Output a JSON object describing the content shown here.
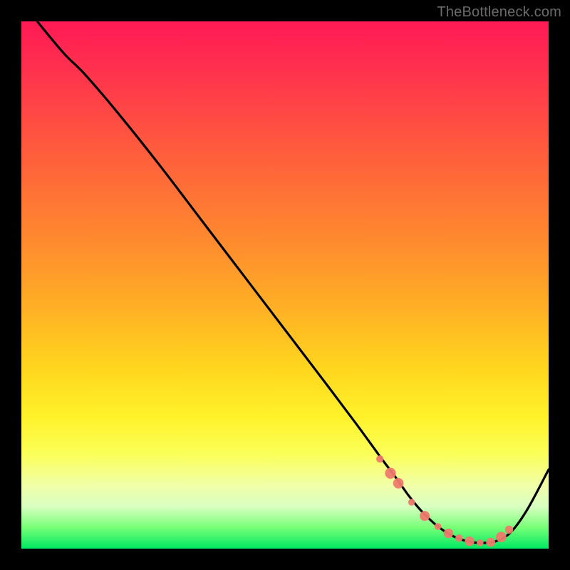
{
  "watermark": "TheBottleneck.com",
  "chart_data": {
    "type": "line",
    "title": "",
    "xlabel": "",
    "ylabel": "",
    "xlim": [
      0,
      100
    ],
    "ylim": [
      0,
      100
    ],
    "series": [
      {
        "name": "curve",
        "color": "#000000",
        "x": [
          3,
          8,
          12,
          18,
          26,
          34,
          42,
          50,
          58,
          64,
          68,
          71,
          73.5,
          76,
          79,
          82,
          85,
          88,
          90.5,
          93,
          96,
          100
        ],
        "y": [
          100,
          94,
          90,
          83,
          73,
          62.5,
          52,
          41.5,
          31,
          23,
          17.5,
          13.5,
          10,
          7,
          4.2,
          2.3,
          1.3,
          1.1,
          1.6,
          3.3,
          7.5,
          15
        ]
      }
    ],
    "markers": {
      "name": "highlight-points",
      "color": "#ef7a6d",
      "x": [
        68,
        70,
        71.5,
        74,
        76.5,
        79,
        81,
        83,
        85,
        87,
        89,
        91,
        92.5
      ],
      "y": [
        17,
        14.3,
        12.4,
        8.8,
        6.2,
        4.2,
        2.9,
        2.0,
        1.4,
        1.1,
        1.2,
        2.2,
        3.6
      ],
      "r": [
        3.2,
        4.8,
        4.6,
        3.0,
        4.4,
        3.0,
        4.2,
        3.2,
        4.2,
        3.0,
        4.0,
        4.6,
        3.6
      ]
    }
  }
}
